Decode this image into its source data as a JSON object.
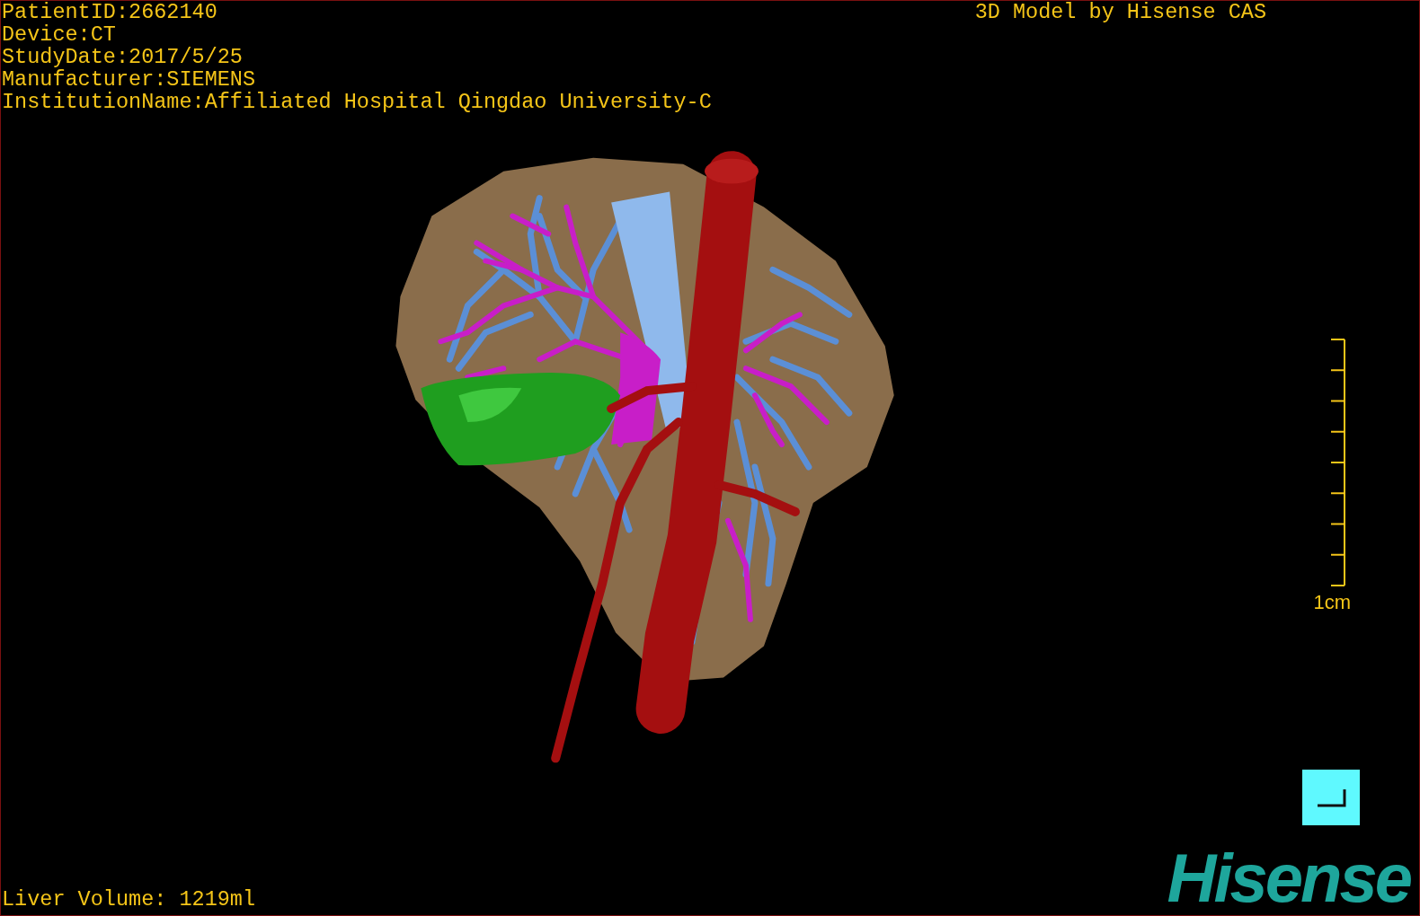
{
  "patient_info": [
    "PatientID:2662140",
    "Device:CT",
    "StudyDate:2017/5/25",
    "Manufacturer:SIEMENS",
    "InstitutionName:Affiliated Hospital Qingdao University-C"
  ],
  "title": "3D Model by Hisense CAS",
  "scale_bar": {
    "label": "1cm"
  },
  "liver_volume": "Liver Volume: 1219ml",
  "logo": "Hisense"
}
